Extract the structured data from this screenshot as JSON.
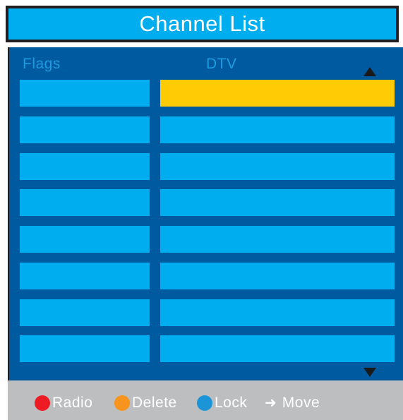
{
  "title": "Channel List",
  "columns": {
    "flags": "Flags",
    "dtv": "DTV"
  },
  "rows": [
    {
      "flags": "",
      "name": "",
      "selected": true
    },
    {
      "flags": "",
      "name": "",
      "selected": false
    },
    {
      "flags": "",
      "name": "",
      "selected": false
    },
    {
      "flags": "",
      "name": "",
      "selected": false
    },
    {
      "flags": "",
      "name": "",
      "selected": false
    },
    {
      "flags": "",
      "name": "",
      "selected": false
    },
    {
      "flags": "",
      "name": "",
      "selected": false
    },
    {
      "flags": "",
      "name": "",
      "selected": false
    }
  ],
  "icons": {
    "scroll_up": "triangle-up-icon",
    "scroll_down": "triangle-down-icon",
    "move": "arrow-right-icon"
  },
  "legend": {
    "radio": {
      "label": "Radio",
      "color": "#ed1c24"
    },
    "delete": {
      "label": "Delete",
      "color": "#f7941d"
    },
    "lock": {
      "label": "Lock",
      "color": "#1b95d8"
    },
    "move": {
      "label": "Move"
    }
  },
  "colors": {
    "title_bg": "#00adef",
    "panel_bg": "#005aa0",
    "cell_bg": "#00adef",
    "selected_bg": "#ffcb05",
    "header_text": "#1e9be0",
    "footer_bg": "#bcbec0"
  }
}
